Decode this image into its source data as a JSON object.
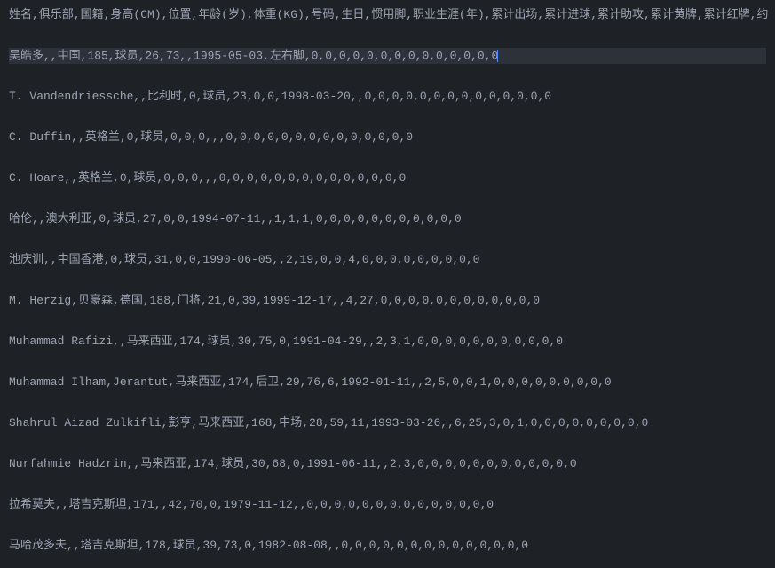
{
  "lines": [
    {
      "text": "姓名,俱乐部,国籍,身高(CM),位置,年龄(岁),体重(KG),号码,生日,惯用脚,职业生涯(年),累计出场,累计进球,累计助攻,累计黄牌,累计红牌,约",
      "type": "header",
      "active": false
    },
    {
      "text": "吴皓多,,中国,185,球员,26,73,,1995-05-03,左右脚,0,0,0,0,0,0,0,0,0,0,0,0,0,0",
      "type": "data",
      "active": true
    },
    {
      "text": "T. Vandendriessche,,比利时,0,球员,23,0,0,1998-03-20,,0,0,0,0,0,0,0,0,0,0,0,0,0,0",
      "type": "data",
      "active": false
    },
    {
      "text": "C. Duffin,,英格兰,0,球员,0,0,0,,,0,0,0,0,0,0,0,0,0,0,0,0,0,0",
      "type": "data",
      "active": false
    },
    {
      "text": "C. Hoare,,英格兰,0,球员,0,0,0,,,0,0,0,0,0,0,0,0,0,0,0,0,0,0",
      "type": "data",
      "active": false
    },
    {
      "text": "哈伦,,澳大利亚,0,球员,27,0,0,1994-07-11,,1,1,1,0,0,0,0,0,0,0,0,0,0,0",
      "type": "data",
      "active": false
    },
    {
      "text": "池庆训,,中国香港,0,球员,31,0,0,1990-06-05,,2,19,0,0,4,0,0,0,0,0,0,0,0,0",
      "type": "data",
      "active": false
    },
    {
      "text": "M. Herzig,贝豪森,德国,188,门将,21,0,39,1999-12-17,,4,27,0,0,0,0,0,0,0,0,0,0,0,0",
      "type": "data",
      "active": false
    },
    {
      "text": "Muhammad Rafizi,,马来西亚,174,球员,30,75,0,1991-04-29,,2,3,1,0,0,0,0,0,0,0,0,0,0,0",
      "type": "data",
      "active": false
    },
    {
      "text": "Muhammad Ilham,Jerantut,马来西亚,174,后卫,29,76,6,1992-01-11,,2,5,0,0,1,0,0,0,0,0,0,0,0,0",
      "type": "data",
      "active": false
    },
    {
      "text": "Shahrul Aizad Zulkifli,彭亨,马来西亚,168,中场,28,59,11,1993-03-26,,6,25,3,0,1,0,0,0,0,0,0,0,0,0",
      "type": "data",
      "active": false
    },
    {
      "text": "Nurfahmie Hadzrin,,马来西亚,174,球员,30,68,0,1991-06-11,,2,3,0,0,0,0,0,0,0,0,0,0,0,0",
      "type": "data",
      "active": false
    },
    {
      "text": "拉希莫夫,,塔吉克斯坦,171,,42,70,0,1979-11-12,,0,0,0,0,0,0,0,0,0,0,0,0,0,0",
      "type": "data",
      "active": false
    },
    {
      "text": "马哈茂多夫,,塔吉克斯坦,178,球员,39,73,0,1982-08-08,,0,0,0,0,0,0,0,0,0,0,0,0,0,0",
      "type": "data",
      "active": false
    }
  ]
}
